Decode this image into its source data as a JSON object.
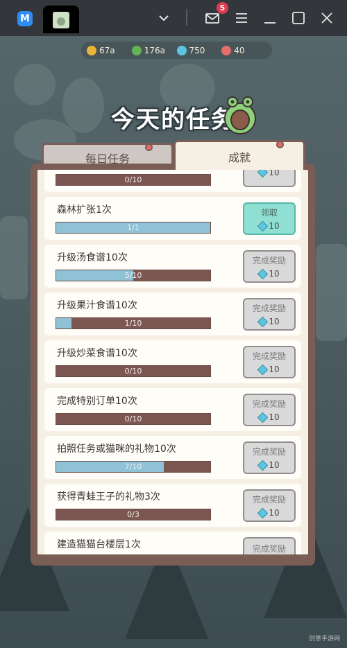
{
  "titlebar": {
    "app_icon": "M",
    "notification_count": "5",
    "icons": [
      "app-logo-icon",
      "game-tab-thumbnail",
      "chevron-down-icon",
      "mail-icon",
      "menu-icon",
      "minimize-icon",
      "maximize-icon",
      "close-icon"
    ]
  },
  "resources": [
    {
      "icon": "gold-coin-icon",
      "value": "67a",
      "color": "#e8b43a"
    },
    {
      "icon": "leaf-icon",
      "value": "176a",
      "color": "#63b35b"
    },
    {
      "icon": "diamond-icon",
      "value": "750",
      "color": "#5dc5e0"
    },
    {
      "icon": "heart-icon",
      "value": "40",
      "color": "#e46d6d"
    }
  ],
  "panel": {
    "title": "今天的任务",
    "tabs": [
      {
        "label": "每日任务",
        "active": false
      },
      {
        "label": "成就",
        "active": true
      }
    ]
  },
  "tasks": [
    {
      "name": "",
      "progress_text": "0/10",
      "fraction": 0.0,
      "button": "",
      "reward": "10",
      "state": "locked"
    },
    {
      "name": "森林扩张1次",
      "progress_text": "1/1",
      "fraction": 1.0,
      "button": "领取",
      "reward": "10",
      "state": "claimable"
    },
    {
      "name": "升级汤食谱10次",
      "progress_text": "5/10",
      "fraction": 0.5,
      "button": "完成奖励",
      "reward": "10",
      "state": "locked"
    },
    {
      "name": "升级果汁食谱10次",
      "progress_text": "1/10",
      "fraction": 0.1,
      "button": "完成奖励",
      "reward": "10",
      "state": "locked"
    },
    {
      "name": "升级炒菜食谱10次",
      "progress_text": "0/10",
      "fraction": 0.0,
      "button": "完成奖励",
      "reward": "10",
      "state": "locked"
    },
    {
      "name": "完成特别订单10次",
      "progress_text": "0/10",
      "fraction": 0.0,
      "button": "完成奖励",
      "reward": "10",
      "state": "locked"
    },
    {
      "name": "拍照任务或猫咪的礼物10次",
      "progress_text": "7/10",
      "fraction": 0.7,
      "button": "完成奖励",
      "reward": "10",
      "state": "locked"
    },
    {
      "name": "获得青蛙王子的礼物3次",
      "progress_text": "0/3",
      "fraction": 0.0,
      "button": "完成奖励",
      "reward": "10",
      "state": "locked"
    },
    {
      "name": "建造猫猫台楼层1次",
      "progress_text": "",
      "fraction": 0.0,
      "button": "完成奖励",
      "reward": "",
      "state": "locked"
    }
  ],
  "watermark": "创意手游网"
}
